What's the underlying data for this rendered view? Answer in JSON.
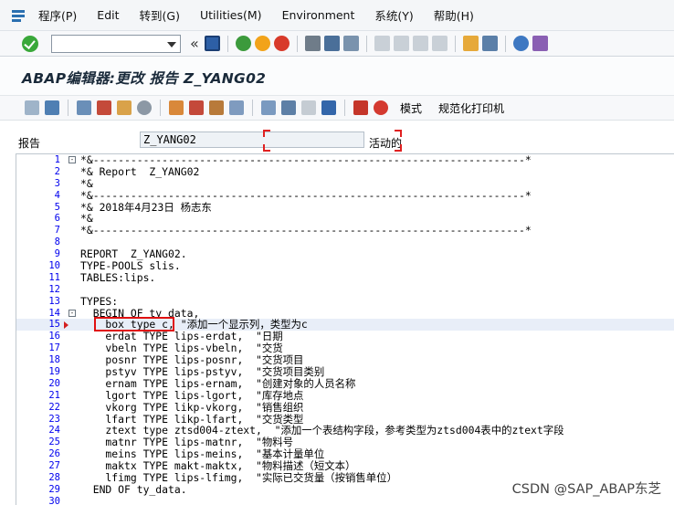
{
  "menu": [
    "程序(P)",
    "Edit",
    "转到(G)",
    "Utilities(M)",
    "Environment",
    "系统(Y)",
    "帮助(H)"
  ],
  "title": "ABAP编辑器:更改 报告 Z_YANG02",
  "toolbar": {
    "command_value": "",
    "back_glyph": "«"
  },
  "app_toolbar": {
    "mode_label": "模式",
    "pretty_print_label": "规范化打印机"
  },
  "report": {
    "label": "报告",
    "value": "Z_YANG02",
    "status": "活动的"
  },
  "editor": {
    "current_line": 15,
    "lines": [
      {
        "n": "1",
        "fold": "⊟",
        "text": "*&---------------------------------------------------------------------*"
      },
      {
        "n": "2",
        "fold": "",
        "text": "*& Report  Z_YANG02"
      },
      {
        "n": "3",
        "fold": "",
        "text": "*&"
      },
      {
        "n": "4",
        "fold": "",
        "text": "*&---------------------------------------------------------------------*"
      },
      {
        "n": "5",
        "fold": "",
        "text": "*& 2018年4月23日 杨志东"
      },
      {
        "n": "6",
        "fold": "",
        "text": "*&"
      },
      {
        "n": "7",
        "fold": "",
        "text": "*&---------------------------------------------------------------------*"
      },
      {
        "n": "8",
        "fold": "",
        "text": ""
      },
      {
        "n": "9",
        "fold": "",
        "text": "REPORT  Z_YANG02."
      },
      {
        "n": "10",
        "fold": "",
        "text": "TYPE-POOLS slis."
      },
      {
        "n": "11",
        "fold": "",
        "text": "TABLES:lips."
      },
      {
        "n": "12",
        "fold": "",
        "text": ""
      },
      {
        "n": "13",
        "fold": "",
        "text": "TYPES:"
      },
      {
        "n": "14",
        "fold": "⊟",
        "text": "  BEGIN OF ty_data,"
      },
      {
        "n": "15",
        "fold": "",
        "text": "    box type c, \"添加一个显示列，类型为c"
      },
      {
        "n": "16",
        "fold": "",
        "text": "    erdat TYPE lips-erdat,  \"日期"
      },
      {
        "n": "17",
        "fold": "",
        "text": "    vbeln TYPE lips-vbeln,  \"交货"
      },
      {
        "n": "18",
        "fold": "",
        "text": "    posnr TYPE lips-posnr,  \"交货项目"
      },
      {
        "n": "19",
        "fold": "",
        "text": "    pstyv TYPE lips-pstyv,  \"交货项目类别"
      },
      {
        "n": "20",
        "fold": "",
        "text": "    ernam TYPE lips-ernam,  \"创建对象的人员名称"
      },
      {
        "n": "21",
        "fold": "",
        "text": "    lgort TYPE lips-lgort,  \"库存地点"
      },
      {
        "n": "22",
        "fold": "",
        "text": "    vkorg TYPE likp-vkorg,  \"销售组织"
      },
      {
        "n": "23",
        "fold": "",
        "text": "    lfart TYPE likp-lfart,  \"交货类型"
      },
      {
        "n": "24",
        "fold": "",
        "text": "    ztext type ztsd004-ztext,  \"添加一个表结构字段，参考类型为ztsd004表中的ztext字段"
      },
      {
        "n": "25",
        "fold": "",
        "text": "    matnr TYPE lips-matnr,  \"物料号"
      },
      {
        "n": "26",
        "fold": "",
        "text": "    meins TYPE lips-meins,  \"基本计量单位"
      },
      {
        "n": "27",
        "fold": "",
        "text": "    maktx TYPE makt-maktx,  \"物料描述（短文本）"
      },
      {
        "n": "28",
        "fold": "",
        "text": "    lfimg TYPE lips-lfimg,  \"实际已交货量（按销售单位）"
      },
      {
        "n": "29",
        "fold": "",
        "text": "  END OF ty_data."
      },
      {
        "n": "30",
        "fold": "",
        "text": ""
      }
    ]
  },
  "watermark": "CSDN @SAP_ABAP东芝",
  "colors": {
    "accent_blue": "#2a6fb0",
    "line_number": "#0000ee",
    "highlight_red": "#e01010"
  }
}
